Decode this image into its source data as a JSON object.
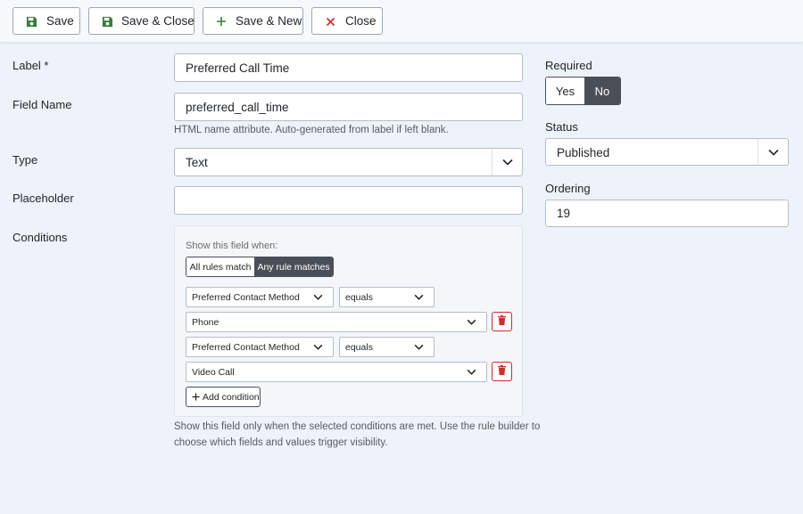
{
  "toolbar": {
    "save": "Save",
    "save_close": "Save & Close",
    "save_new": "Save & New",
    "close": "Close"
  },
  "form": {
    "label": {
      "label": "Label *",
      "value": "Preferred Call Time"
    },
    "field_name": {
      "label": "Field Name",
      "value": "preferred_call_time",
      "hint": "HTML name attribute. Auto-generated from label if left blank."
    },
    "type": {
      "label": "Type",
      "value": "Text"
    },
    "placeholder": {
      "label": "Placeholder",
      "value": ""
    },
    "conditions": {
      "label": "Conditions",
      "show_when": "Show this field when:",
      "match_options": [
        "All rules match",
        "Any rule matches"
      ],
      "selected_match": "Any rule matches",
      "rules": [
        {
          "field": "Preferred Contact Method",
          "operator": "equals",
          "value": "Phone"
        },
        {
          "field": "Preferred Contact Method",
          "operator": "equals",
          "value": "Video Call"
        }
      ],
      "add_label": "Add condition",
      "hint_line1": "Show this field only when the selected conditions are met. Use the rule builder to",
      "hint_line2": "choose which fields and values trigger visibility."
    }
  },
  "sidebar": {
    "required": {
      "label": "Required",
      "options": [
        "Yes",
        "No"
      ],
      "selected": "No"
    },
    "status": {
      "label": "Status",
      "value": "Published"
    },
    "ordering": {
      "label": "Ordering",
      "value": "19"
    }
  },
  "colors": {
    "save_icon": "#3a7d3a",
    "close_icon": "#c9302c",
    "active_toggle": "#4a4f57",
    "page_bg": "#eef2f9"
  }
}
